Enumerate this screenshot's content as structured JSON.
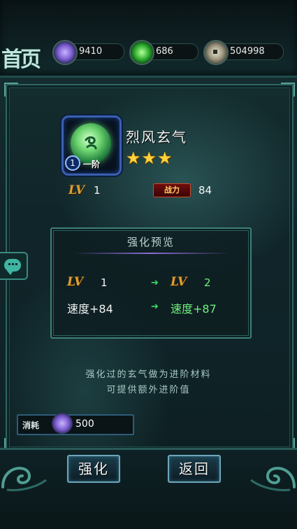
{
  "header": {
    "home_label": "首页",
    "resources": [
      {
        "name": "gems",
        "icon": "crystal-icon",
        "value": "9410"
      },
      {
        "name": "jade",
        "icon": "jade-icon",
        "value": "686"
      },
      {
        "name": "coins",
        "icon": "coin-icon",
        "value": "504998"
      }
    ]
  },
  "item": {
    "name": "烈风玄气",
    "level_badge": "1",
    "stage": "一阶",
    "stars": [
      "★",
      "★",
      "★"
    ],
    "lv_label": "LV",
    "lv_value": "1",
    "power_label": "战力",
    "power_value": "84"
  },
  "preview": {
    "title": "强化预览",
    "from": {
      "lv_label": "LV",
      "lv_value": "1",
      "speed": "速度+84"
    },
    "to": {
      "lv_label": "LV",
      "lv_value": "2",
      "speed": "速度+87"
    },
    "arrow": "➔"
  },
  "hint": {
    "line1": "强化过的玄气做为进阶材料",
    "line2": "可提供额外进阶值"
  },
  "cost": {
    "label": "消耗",
    "icon": "crystal-icon",
    "value": "500"
  },
  "buttons": {
    "enhance": "强化",
    "back": "返回"
  },
  "colors": {
    "accent_teal": "#3d8077",
    "lv_gold": "#e0a030",
    "arrow_green": "#39e06a",
    "next_green": "#6ff07a",
    "star_gold": "#ffd23a"
  }
}
